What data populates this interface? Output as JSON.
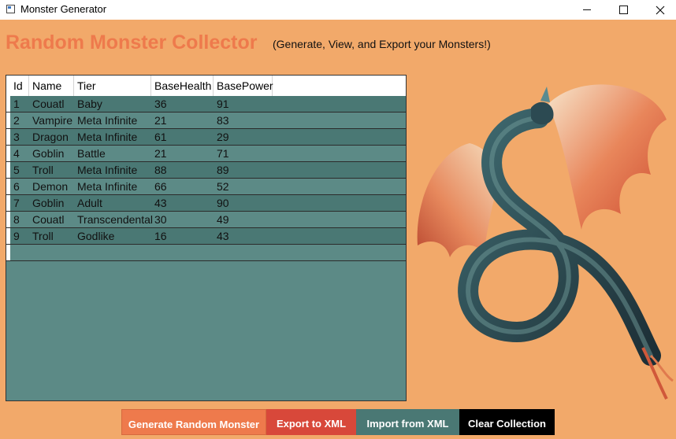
{
  "window": {
    "title": "Monster Generator"
  },
  "header": {
    "title": "Random Monster Collector",
    "subtitle": "(Generate, View, and Export your Monsters!)"
  },
  "grid": {
    "columns": [
      "Id",
      "Name",
      "Tier",
      "BaseHealth",
      "BasePower"
    ],
    "rows": [
      [
        "1",
        "Couatl",
        "Baby",
        "36",
        "91"
      ],
      [
        "2",
        "Vampire",
        "Meta Infinite",
        "21",
        "83"
      ],
      [
        "3",
        "Dragon",
        "Meta Infinite",
        "61",
        "29"
      ],
      [
        "4",
        "Goblin",
        "Battle",
        "21",
        "71"
      ],
      [
        "5",
        "Troll",
        "Meta Infinite",
        "88",
        "89"
      ],
      [
        "6",
        "Demon",
        "Meta Infinite",
        "66",
        "52"
      ],
      [
        "7",
        "Goblin",
        "Adult",
        "43",
        "90"
      ],
      [
        "8",
        "Couatl",
        "Transcendental",
        "30",
        "49"
      ],
      [
        "9",
        "Troll",
        "Godlike",
        "16",
        "43"
      ]
    ]
  },
  "buttons": {
    "generate": "Generate Random Monster",
    "export": "Export to XML",
    "import": "Import from XML",
    "clear": "Clear Collection"
  },
  "image": {
    "icon": "dragon-illustration"
  },
  "colors": {
    "background": "#F2A96A",
    "title": "#EE7A4C",
    "grid_row_dark": "#4A7874",
    "grid_row_light": "#5C8A86",
    "button_generate": "#EE7A4C",
    "button_export": "#D8483A",
    "button_import": "#4A7874",
    "button_clear": "#000000"
  }
}
